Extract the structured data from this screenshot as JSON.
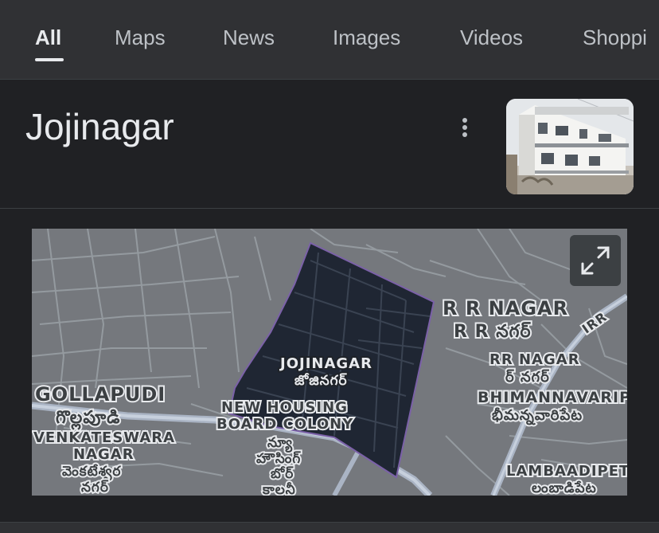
{
  "tabs": [
    {
      "label": "All",
      "active": true
    },
    {
      "label": "Maps",
      "active": false
    },
    {
      "label": "News",
      "active": false
    },
    {
      "label": "Images",
      "active": false
    },
    {
      "label": "Videos",
      "active": false
    },
    {
      "label": "Shoppi",
      "active": false
    }
  ],
  "header": {
    "title": "Jojinagar",
    "more_icon": "more-vert-icon",
    "thumbnail_icon": "building-photo"
  },
  "map": {
    "expand_icon": "expand-icon",
    "labels": {
      "rr_nagar_big_en": "R R NAGAR",
      "rr_nagar_big_te": "R R నగర్",
      "irr": "IRR",
      "rr_nagar_en": "RR NAGAR",
      "rr_nagar_te": "ర్ నగర్",
      "bhimannavaripet_en": "BHIMANNAVARIP",
      "bhimannavaripet_te": "భీమన్నవారిపేట",
      "lambaadipet_en": "LAMBAADIPET",
      "lambaadipet_te": "లంబాడిపేట",
      "jojinagar_en": "JOJINAGAR",
      "jojinagar_te": "జోజినగర్",
      "new_housing_en_1": "NEW HOUSING",
      "new_housing_en_2": "BOARD COLONY",
      "new_housing_te_1": "న్యూ",
      "new_housing_te_2": "హౌసింగ్",
      "new_housing_te_3": "బోర్",
      "new_housing_te_4": "కాలనీ",
      "gollapudi_en": "GOLLAPUDI",
      "gollapudi_te": "గొల్లపూడి",
      "venkateswara_en_1": "VENKATESWARA",
      "venkateswara_en_2": "NAGAR",
      "venkateswara_te_1": "వెంకటేశ్వర",
      "venkateswara_te_2": "నగర్"
    },
    "colors": {
      "background": "#75787d",
      "roads": "#9aa0a6",
      "highlight_fill": "#1f2633",
      "highlight_border": "#7b61a8"
    }
  }
}
